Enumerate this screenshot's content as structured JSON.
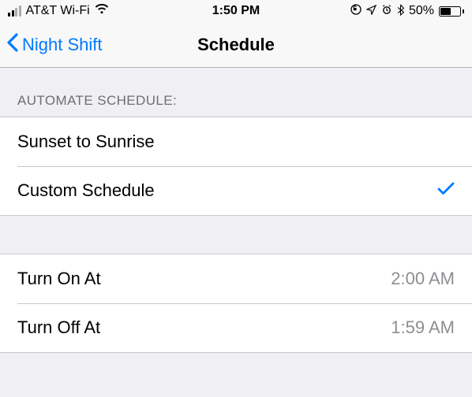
{
  "status": {
    "carrier": "AT&T Wi-Fi",
    "time": "1:50 PM",
    "battery_pct": "50%"
  },
  "nav": {
    "back_label": "Night Shift",
    "title": "Schedule"
  },
  "automate_header": "AUTOMATE SCHEDULE:",
  "schedule_options": {
    "sunset": "Sunset to Sunrise",
    "custom": "Custom Schedule"
  },
  "times": {
    "on_label": "Turn On At",
    "on_value": "2:00 AM",
    "off_label": "Turn Off At",
    "off_value": "1:59 AM"
  }
}
